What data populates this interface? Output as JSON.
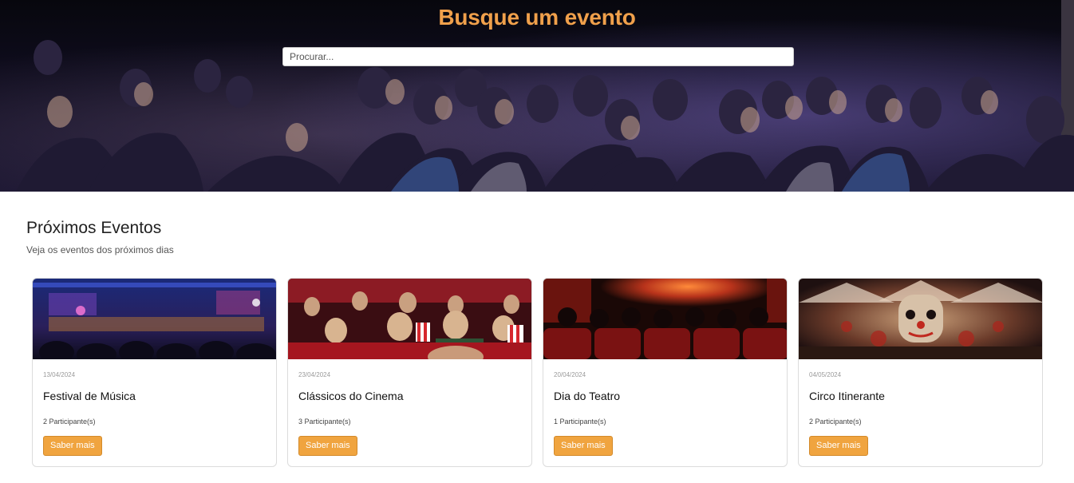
{
  "hero": {
    "title": "Busque um evento",
    "search_placeholder": "Procurar..."
  },
  "section": {
    "title": "Próximos Eventos",
    "subtitle": "Veja os eventos dos próximos dias"
  },
  "events": [
    {
      "date": "13/04/2024",
      "title": "Festival de Música",
      "participants": "2 Participante(s)",
      "button": "Saber mais",
      "image": "concert-stage-photo"
    },
    {
      "date": "23/04/2024",
      "title": "Clássicos do Cinema",
      "participants": "3 Participante(s)",
      "button": "Saber mais",
      "image": "cinema-audience-popcorn-photo"
    },
    {
      "date": "20/04/2024",
      "title": "Dia do Teatro",
      "participants": "1 Participante(s)",
      "button": "Saber mais",
      "image": "theater-stage-red-seats-photo"
    },
    {
      "date": "04/05/2024",
      "title": "Circo Itinerante",
      "participants": "2 Participante(s)",
      "button": "Saber mais",
      "image": "circus-tent-clown-photo"
    }
  ],
  "colors": {
    "accent": "#f0a04b",
    "button": "#f0a43f"
  }
}
